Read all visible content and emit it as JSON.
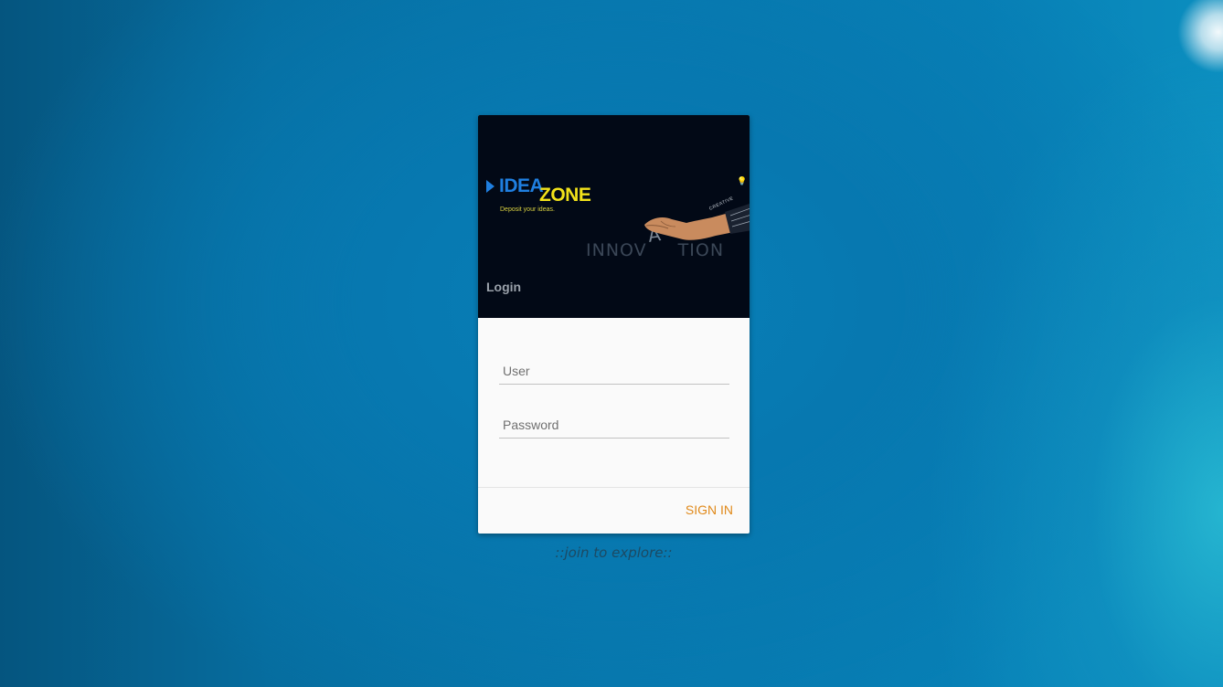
{
  "login_card": {
    "banner": {
      "logo": {
        "word1": "IDEA",
        "word2": "ZONE",
        "tagline": "Deposit your ideas."
      },
      "image_text": {
        "left": "INNOV",
        "letter": "A",
        "right": "TION",
        "tag": "CREATIVE"
      },
      "title": "Login"
    },
    "form": {
      "user": {
        "placeholder": "User",
        "value": ""
      },
      "password": {
        "placeholder": "Password",
        "value": ""
      }
    },
    "actions": {
      "sign_in_label": "SIGN IN"
    }
  },
  "footer": {
    "tagline": "::join to explore::"
  },
  "colors": {
    "logo_idea": "#1f7fe0",
    "logo_zone": "#f2e21a",
    "sign_in": "#e0891a",
    "background": "#0778ad"
  },
  "icons": [
    "play-arrow-icon",
    "hand-icon",
    "lightbulb-icon"
  ]
}
